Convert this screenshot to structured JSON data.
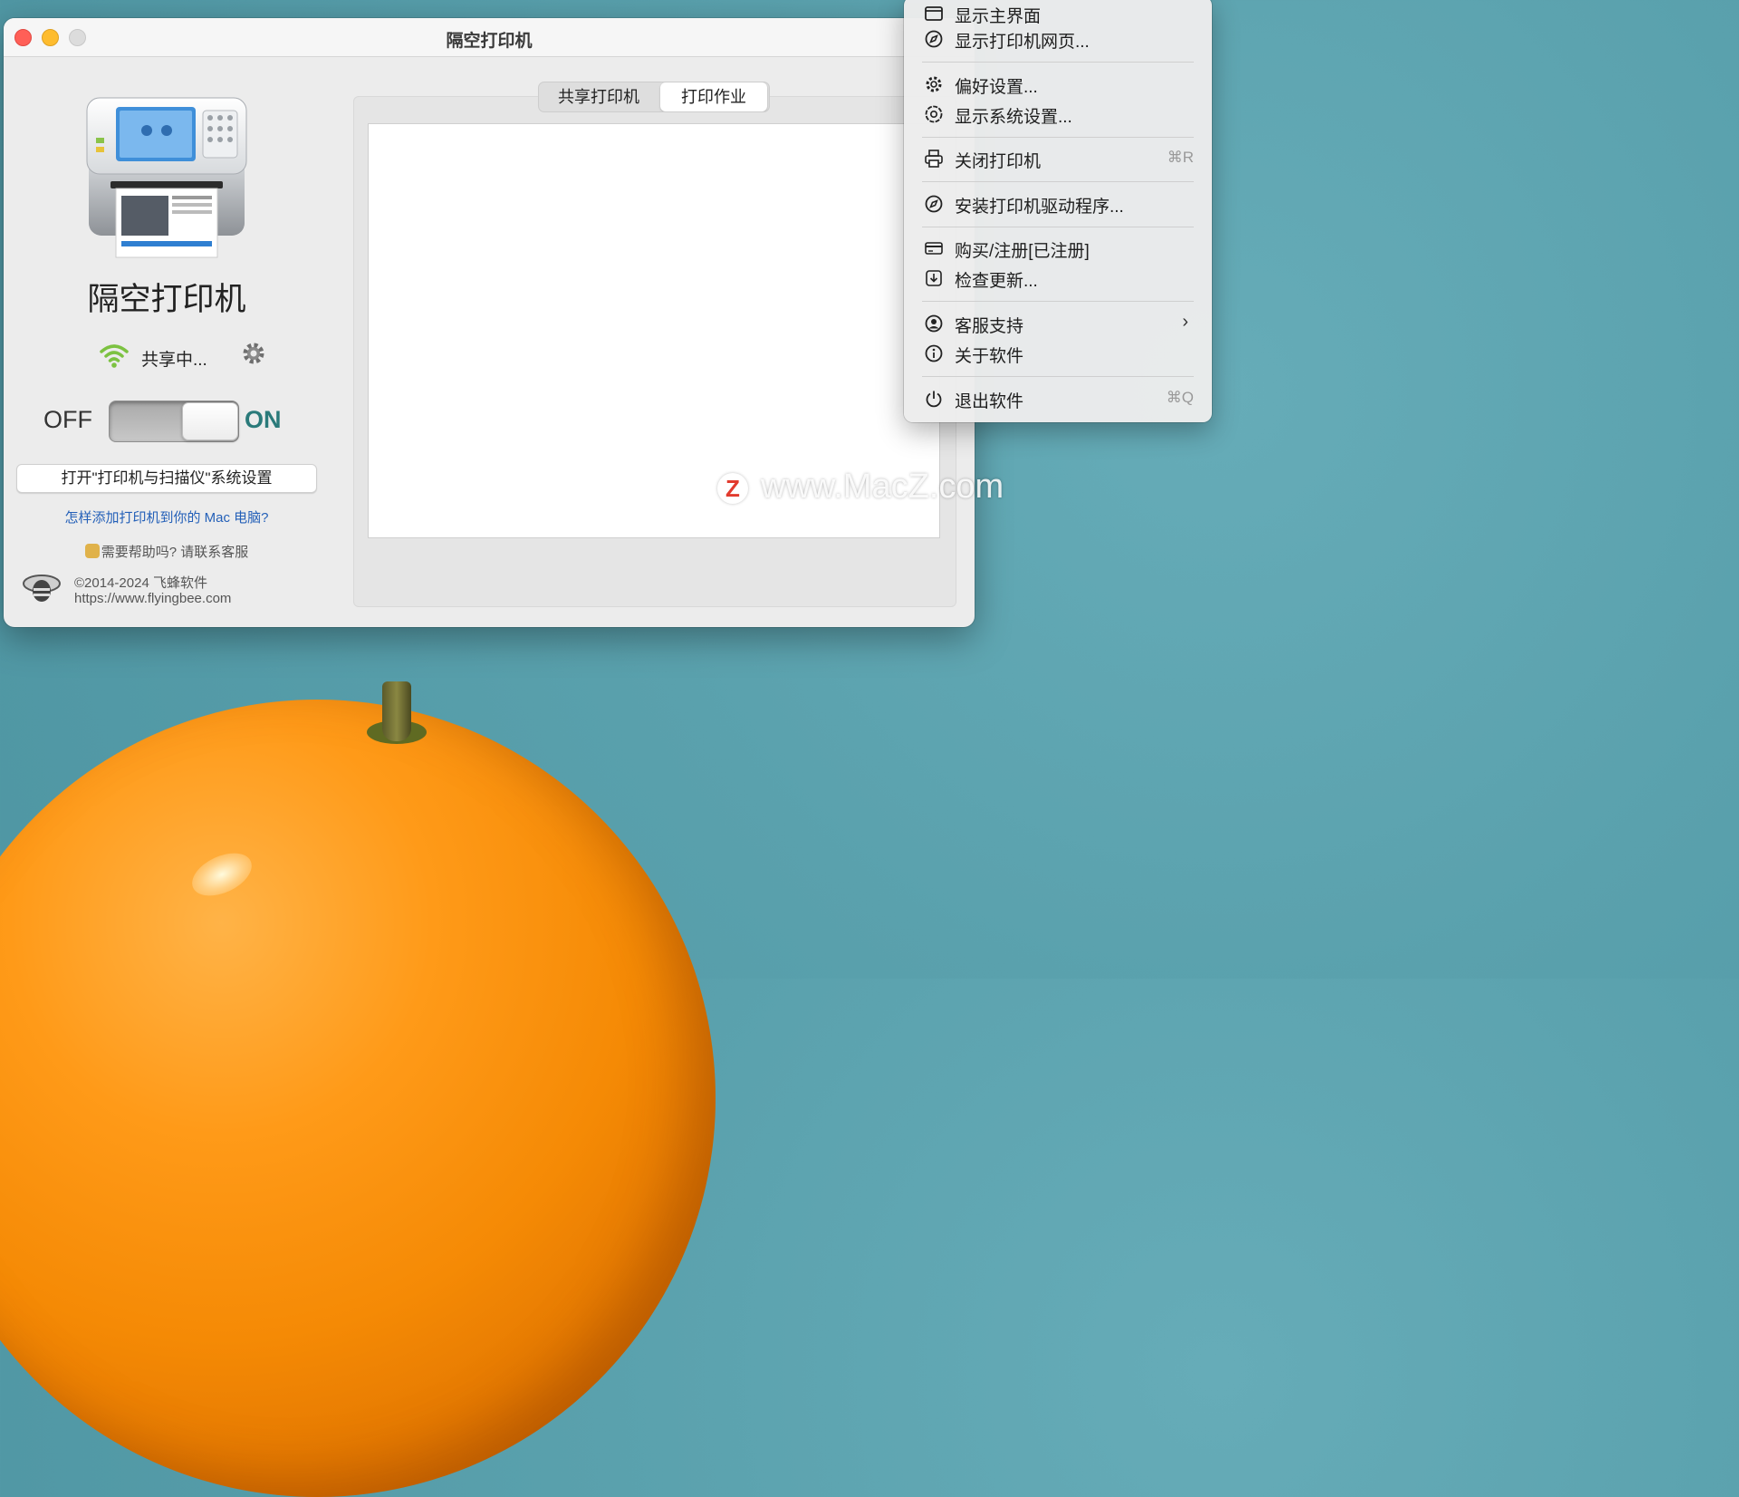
{
  "window": {
    "title": "隔空打印机"
  },
  "left_panel": {
    "app_name": "隔空打印机",
    "status_text": "共享中...",
    "toggle_off_label": "OFF",
    "toggle_on_label": "ON",
    "toggle_state": "on",
    "open_settings_button": "打开\"打印机与扫描仪\"系统设置",
    "howto_link": "怎样添加打印机到你的 Mac 电脑?",
    "help_text": "需要帮助吗? 请联系客服",
    "copyright": "©2014-2024 飞蜂软件",
    "website": "https://www.flyingbee.com"
  },
  "tabs": [
    {
      "label": "共享打印机",
      "selected": false
    },
    {
      "label": "打印作业",
      "selected": true
    }
  ],
  "watermark": {
    "logo_letter": "Z",
    "text": "www.MacZ.com"
  },
  "menu": {
    "items": [
      {
        "label": "显示主界面",
        "icon": "window-icon",
        "shortcut": ""
      },
      {
        "label": "显示打印机网页...",
        "icon": "compass-icon",
        "shortcut": ""
      },
      {
        "label": "偏好设置...",
        "icon": "gear-icon",
        "shortcut": ""
      },
      {
        "label": "显示系统设置...",
        "icon": "settings-badge-icon",
        "shortcut": ""
      },
      {
        "label": "关闭打印机",
        "icon": "printer-icon",
        "shortcut": "⌘R"
      },
      {
        "label": "安装打印机驱动程序...",
        "icon": "compass-icon",
        "shortcut": ""
      },
      {
        "label": "购买/注册[已注册]",
        "icon": "credit-card-icon",
        "shortcut": ""
      },
      {
        "label": "检查更新...",
        "icon": "download-icon",
        "shortcut": ""
      },
      {
        "label": "客服支持",
        "icon": "person-circle-icon",
        "submenu": true
      },
      {
        "label": "关于软件",
        "icon": "info-icon",
        "shortcut": ""
      },
      {
        "label": "退出软件",
        "icon": "power-icon",
        "shortcut": "⌘Q"
      }
    ]
  },
  "colors": {
    "desktop": "#5aa1ad",
    "on_label": "#2a7a7a",
    "link": "#2460b8"
  }
}
